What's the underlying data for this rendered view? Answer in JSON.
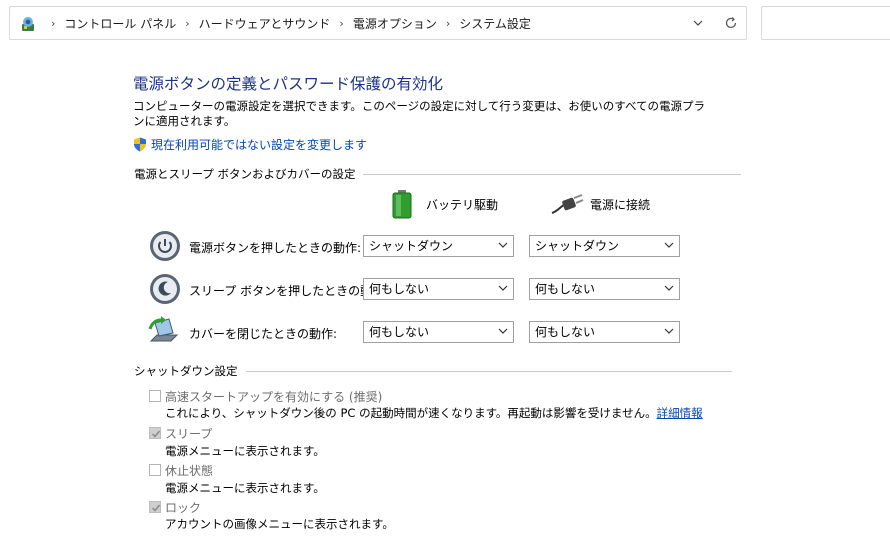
{
  "address_bar": {
    "breadcrumbs": [
      "コントロール パネル",
      "ハードウェアとサウンド",
      "電源オプション",
      "システム設定"
    ],
    "separator": "›"
  },
  "page": {
    "title": "電源ボタンの定義とパスワード保護の有効化",
    "description": "コンピューターの電源設定を選択できます。このページの設定に対して行う変更は、お使いのすべての電源プランに適用されます。",
    "change_link": "現在利用可能ではない設定を変更します"
  },
  "power_section": {
    "heading": "電源とスリープ ボタンおよびカバーの設定",
    "columns": {
      "battery": "バッテリ駆動",
      "plugged": "電源に接続"
    },
    "rows": [
      {
        "label": "電源ボタンを押したときの動作:",
        "battery": "シャットダウン",
        "plugged": "シャットダウン",
        "icon": "power-button-icon"
      },
      {
        "label": "スリープ ボタンを押したときの動作:",
        "battery": "何もしない",
        "plugged": "何もしない",
        "icon": "sleep-button-icon"
      },
      {
        "label": "カバーを閉じたときの動作:",
        "battery": "何もしない",
        "plugged": "何もしない",
        "icon": "laptop-lid-icon"
      }
    ]
  },
  "shutdown_section": {
    "heading": "シャットダウン設定",
    "options": [
      {
        "label": "高速スタートアップを有効にする (推奨)",
        "description": "これにより、シャットダウン後の PC の起動時間が速くなります。再起動は影響を受けません。",
        "link": "詳細情報",
        "checked": false
      },
      {
        "label": "スリープ",
        "description": "電源メニューに表示されます。",
        "checked": true
      },
      {
        "label": "休止状態",
        "description": "電源メニューに表示されます。",
        "checked": false
      },
      {
        "label": "ロック",
        "description": "アカウントの画像メニューに表示されます。",
        "checked": true
      }
    ]
  },
  "colors": {
    "title": "#1e3287",
    "link": "#0046b4",
    "disabled_text": "#6d6d6d"
  }
}
